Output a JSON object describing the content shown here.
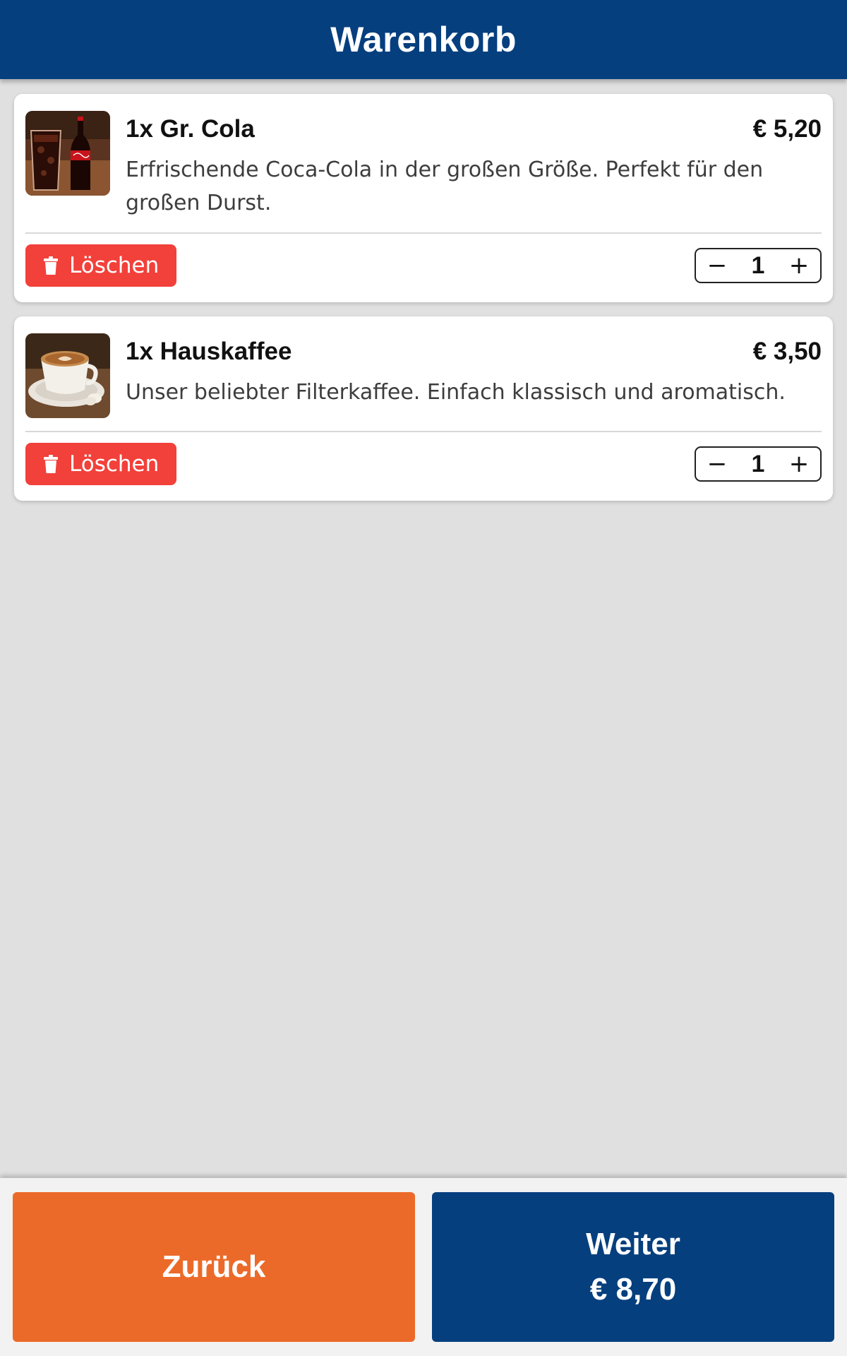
{
  "header": {
    "title": "Warenkorb"
  },
  "cart": {
    "items": [
      {
        "title": "1x Gr. Cola",
        "price": "€ 5,20",
        "description": "Erfrischende Coca-Cola in der großen Größe. Perfekt für den großen Durst.",
        "image_icon": "cola-image",
        "delete_label": "Löschen",
        "quantity": "1",
        "decrement_symbol": "−",
        "increment_symbol": "+"
      },
      {
        "title": "1x Hauskaffee",
        "price": "€ 3,50",
        "description": "Unser beliebter Filterkaffee. Einfach klassisch und aromatisch.",
        "image_icon": "coffee-image",
        "delete_label": "Löschen",
        "quantity": "1",
        "decrement_symbol": "−",
        "increment_symbol": "+"
      }
    ]
  },
  "footer": {
    "back_label": "Zurück",
    "next_label": "Weiter",
    "total": "€ 8,70"
  },
  "colors": {
    "primary": "#063f7e",
    "back_button": "#ec6a29",
    "delete_button": "#f2403a",
    "background": "#e0e0e0"
  }
}
